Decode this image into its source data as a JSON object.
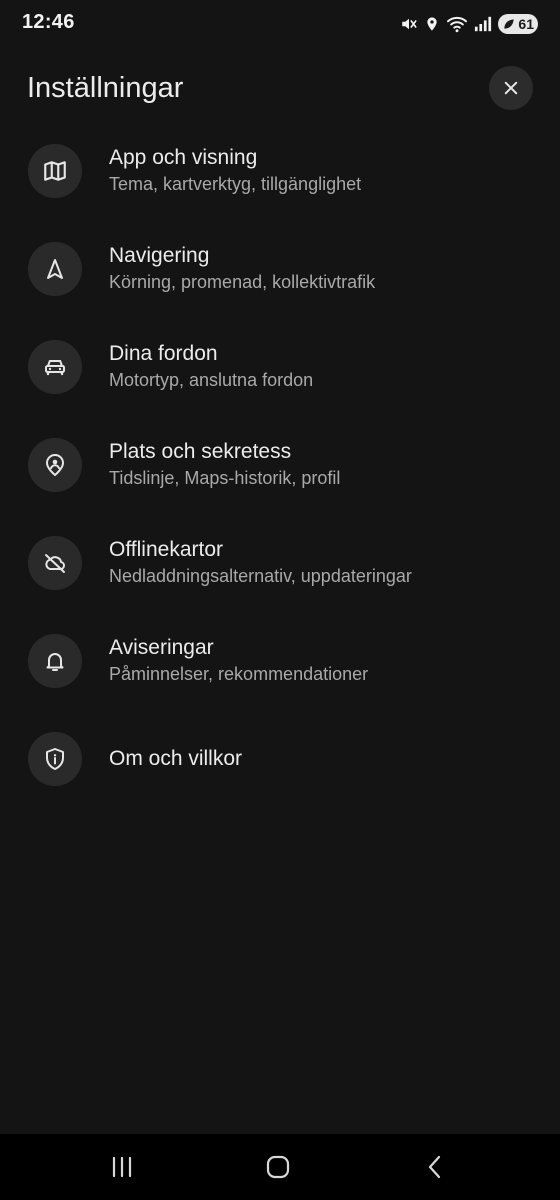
{
  "status_bar": {
    "time": "12:46",
    "battery_level": "61",
    "icons": [
      "mute-icon",
      "location-icon",
      "wifi-icon",
      "signal-icon",
      "battery-icon"
    ]
  },
  "header": {
    "title": "Inställningar",
    "close_icon": "close-icon"
  },
  "settings": [
    {
      "title": "App och visning",
      "subtitle": "Tema, kartverktyg, tillgänglighet",
      "icon": "map-icon"
    },
    {
      "title": "Navigering",
      "subtitle": "Körning, promenad, kollektivtrafik",
      "icon": "navigation-arrow-icon"
    },
    {
      "title": "Dina fordon",
      "subtitle": "Motortyp, anslutna fordon",
      "icon": "car-icon"
    },
    {
      "title": "Plats och sekretess",
      "subtitle": "Tidslinje, Maps-historik, profil",
      "icon": "location-person-icon"
    },
    {
      "title": "Offlinekartor",
      "subtitle": "Nedladdningsalternativ, uppdateringar",
      "icon": "cloud-off-icon"
    },
    {
      "title": "Aviseringar",
      "subtitle": "Påminnelser, rekommendationer",
      "icon": "bell-icon"
    },
    {
      "title": "Om och villkor",
      "icon": "shield-info-icon"
    }
  ],
  "nav_bar": {
    "buttons": [
      "recents-icon",
      "home-icon",
      "back-icon"
    ]
  },
  "colors": {
    "background": "#141414",
    "icon_circle": "#2a2a2a",
    "title_text": "#ececec",
    "subtitle_text": "#a9a9a9"
  }
}
